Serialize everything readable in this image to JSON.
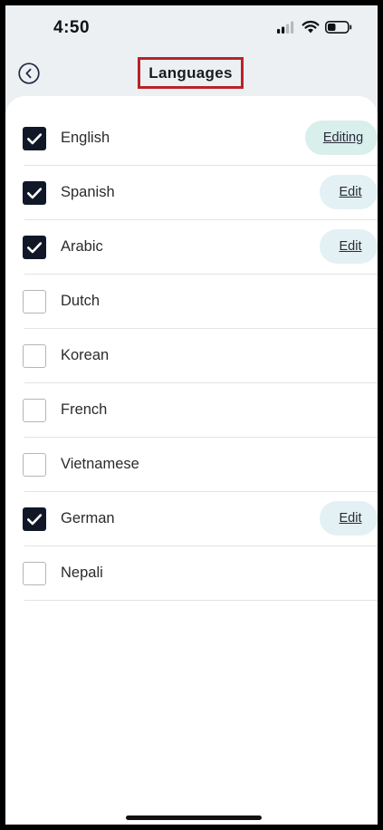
{
  "status_bar": {
    "time": "4:50"
  },
  "header": {
    "title": "Languages",
    "back_icon": "chevron-left-circle-icon"
  },
  "languages": [
    {
      "name": "English",
      "checked": true,
      "action": "Editing"
    },
    {
      "name": "Spanish",
      "checked": true,
      "action": "Edit"
    },
    {
      "name": "Arabic",
      "checked": true,
      "action": "Edit"
    },
    {
      "name": "Dutch",
      "checked": false,
      "action": ""
    },
    {
      "name": "Korean",
      "checked": false,
      "action": ""
    },
    {
      "name": "French",
      "checked": false,
      "action": ""
    },
    {
      "name": "Vietnamese",
      "checked": false,
      "action": ""
    },
    {
      "name": "German",
      "checked": true,
      "action": "Edit"
    },
    {
      "name": "Nepali",
      "checked": false,
      "action": ""
    }
  ],
  "colors": {
    "checked_box": "#101828",
    "pill_background": "#e3f1f4",
    "title_highlight": "#b8232a",
    "header_background": "#edf0f3"
  }
}
